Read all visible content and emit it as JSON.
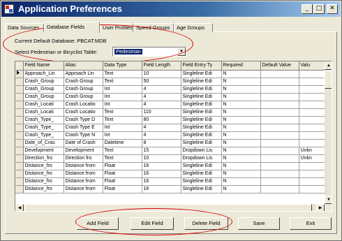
{
  "window": {
    "title": "Application Preferences"
  },
  "titlebar_buttons": {
    "minimize": "_",
    "maximize": "□",
    "close": "✕"
  },
  "tabs": [
    "Data Sources",
    "Database Fields",
    "User Profiles",
    "Speed Groups",
    "Age Groups"
  ],
  "active_tab": "Database Fields",
  "db_info": {
    "current_db_text": "Current Default Database: PBCAT.MDB",
    "select_label": "Select Pedestrian or Bicyclist Table:",
    "select_value": "Pedestrian"
  },
  "grid": {
    "columns": [
      "Field Name",
      "Alias",
      "Data Type",
      "Field Length",
      "Field Entry Ty",
      "Required",
      "Default Value",
      "Valu"
    ],
    "rows": [
      [
        "Approach_Lin",
        "Approach Lin",
        "Text",
        "10",
        "Singleline Edi",
        "N",
        "",
        ""
      ],
      [
        "Crash_Group",
        "Crash Group",
        "Text",
        "50",
        "Singleline Edi",
        "N",
        "",
        ""
      ],
      [
        "Crash_Group",
        "Crash Group",
        "Int",
        "4",
        "Singleline Edi",
        "N",
        "",
        ""
      ],
      [
        "Crash_Group",
        "Crash Group",
        "Int",
        "4",
        "Singleline Edi",
        "N",
        "",
        ""
      ],
      [
        "Crash_Locati",
        "Crash Locatio",
        "Int",
        "4",
        "Singleline Edi",
        "N",
        "",
        ""
      ],
      [
        "Crash_Locati",
        "Crash Locatio",
        "Text",
        "110",
        "Singleline Edi",
        "N",
        "",
        ""
      ],
      [
        "Crash_Type_",
        "Crash Type D",
        "Text",
        "80",
        "Singleline Edi",
        "N",
        "",
        ""
      ],
      [
        "Crash_Type_",
        "Crash Type E",
        "Int",
        "4",
        "Singleline Edi",
        "N",
        "",
        ""
      ],
      [
        "Crash_Type_",
        "Crash Type N",
        "Int",
        "4",
        "Singleline Edi",
        "N",
        "",
        ""
      ],
      [
        "Date_of_Cras",
        "Date of Crash",
        "Datetime",
        "8",
        "Singleline Edi",
        "N",
        "",
        ""
      ],
      [
        "Development",
        "Development",
        "Text",
        "15",
        "Dropdown Lis",
        "N",
        "",
        "Unkn"
      ],
      [
        "Direction_fro",
        "Direction fro",
        "Text",
        "10",
        "Dropdown Lis",
        "N",
        "",
        "Unkn"
      ],
      [
        "Distance_fro",
        "Distance from",
        "Float",
        "16",
        "Singleline Edi",
        "N",
        "",
        ""
      ],
      [
        "Distance_fro",
        "Distance from",
        "Float",
        "16",
        "Singleline Edi",
        "N",
        "",
        ""
      ],
      [
        "Distance_fro",
        "Distance from",
        "Float",
        "16",
        "Singleline Edi",
        "N",
        "",
        ""
      ],
      [
        "Distance_fro",
        "Distance from",
        "Float",
        "16",
        "Singleline Edi",
        "N",
        "",
        ""
      ]
    ]
  },
  "buttons": {
    "add": "Add Field",
    "edit": "Edit Field",
    "delete": "Delete Field",
    "save": "Save",
    "exit": "Exit"
  },
  "colors": {
    "annotation": "#d80000",
    "selection": "#0a246a",
    "titlebar": "#0a246a"
  }
}
